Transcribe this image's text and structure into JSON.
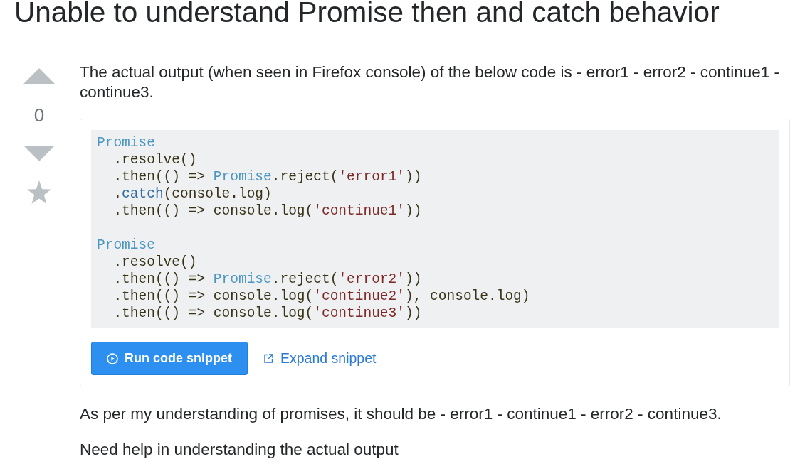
{
  "question": {
    "title": "Unable to understand Promise then and catch behavior"
  },
  "vote": {
    "score": "0",
    "upvoted": false,
    "downvoted": false,
    "favorited": false
  },
  "body": [
    {
      "kind": "paragraph",
      "text": "The actual output (when seen in Firefox console) of the below code is - error1 - error2 - continue1 - continue3."
    },
    {
      "kind": "snippet",
      "code": [
        {
          "lines": [
            [
              {
                "kind": "type",
                "text": "Promise"
              }
            ],
            [
              {
                "kind": "plain",
                "text": "  .resolve()"
              }
            ],
            [
              {
                "kind": "plain",
                "text": "  .then(() => "
              },
              {
                "kind": "type",
                "text": "Promise"
              },
              {
                "kind": "plain",
                "text": ".reject("
              },
              {
                "kind": "string",
                "text": "'error1'"
              },
              {
                "kind": "plain",
                "text": "))"
              }
            ],
            [
              {
                "kind": "plain",
                "text": "  ."
              },
              {
                "kind": "keyword",
                "text": "catch"
              },
              {
                "kind": "plain",
                "text": "(console.log)"
              }
            ],
            [
              {
                "kind": "plain",
                "text": "  .then(() => console.log("
              },
              {
                "kind": "string",
                "text": "'continue1'"
              },
              {
                "kind": "plain",
                "text": "))"
              }
            ]
          ]
        },
        {
          "lines": [
            [
              {
                "kind": "type",
                "text": "Promise"
              }
            ],
            [
              {
                "kind": "plain",
                "text": "  .resolve()"
              }
            ],
            [
              {
                "kind": "plain",
                "text": "  .then(() => "
              },
              {
                "kind": "type",
                "text": "Promise"
              },
              {
                "kind": "plain",
                "text": ".reject("
              },
              {
                "kind": "string",
                "text": "'error2'"
              },
              {
                "kind": "plain",
                "text": "))"
              }
            ],
            [
              {
                "kind": "plain",
                "text": "  .then(() => console.log("
              },
              {
                "kind": "string",
                "text": "'continue2'"
              },
              {
                "kind": "plain",
                "text": "), console.log)"
              }
            ],
            [
              {
                "kind": "plain",
                "text": "  .then(() => console.log("
              },
              {
                "kind": "string",
                "text": "'continue3'"
              },
              {
                "kind": "plain",
                "text": "))"
              }
            ]
          ]
        }
      ],
      "run_button": "Run code snippet",
      "expand_link": "Expand snippet"
    },
    {
      "kind": "paragraph",
      "text": "As per my understanding of promises, it should be - error1 - continue1 - error2 - continue3."
    },
    {
      "kind": "paragraph",
      "text": "Need help in understanding the actual output"
    }
  ]
}
